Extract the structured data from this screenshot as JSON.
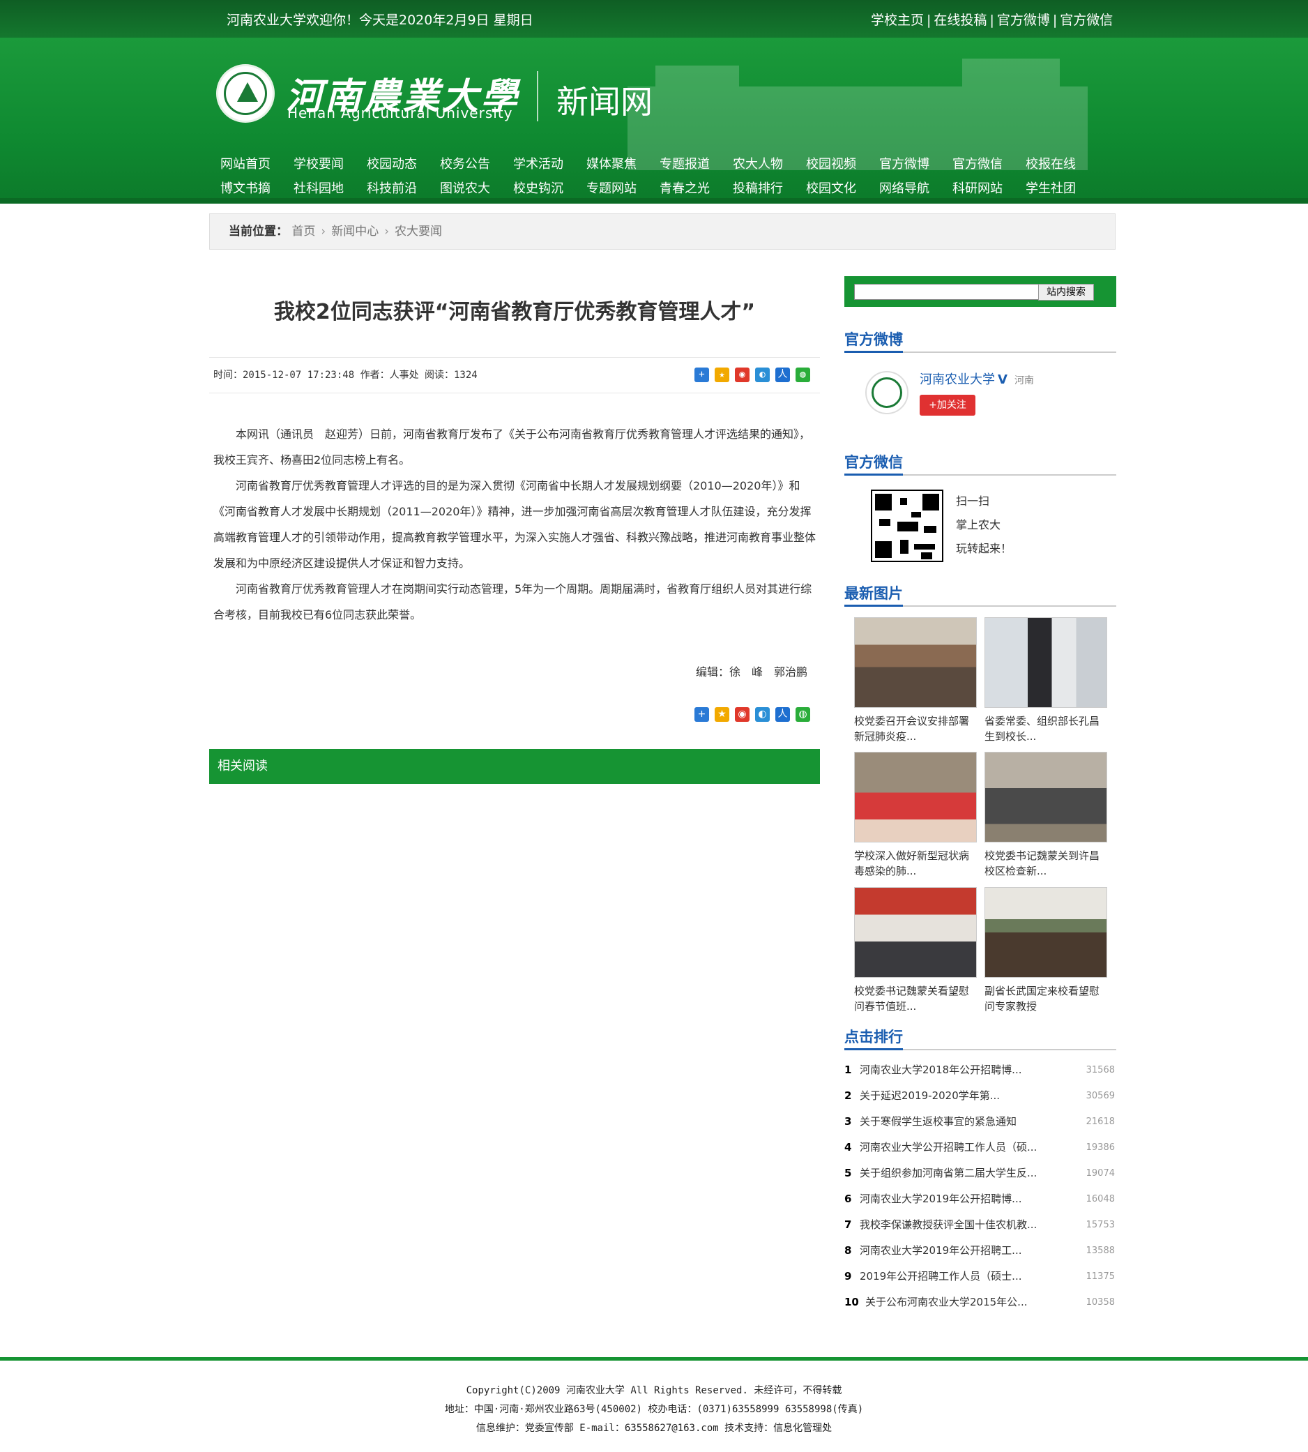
{
  "topbar": {
    "welcome": "河南农业大学欢迎你！今天是2020年2月9日 星期日",
    "links": [
      "学校主页",
      "在线投稿",
      "官方微博",
      "官方微信"
    ]
  },
  "header": {
    "university_cn": "河南農業大學",
    "university_en": "Henan Agricultural University",
    "site_name": "新闻网"
  },
  "nav": {
    "row1": [
      "网站首页",
      "学校要闻",
      "校园动态",
      "校务公告",
      "学术活动",
      "媒体聚焦",
      "专题报道",
      "农大人物",
      "校园视频",
      "官方微博",
      "官方微信",
      "校报在线"
    ],
    "row2": [
      "博文书摘",
      "社科园地",
      "科技前沿",
      "图说农大",
      "校史钩沉",
      "专题网站",
      "青春之光",
      "投稿排行",
      "校园文化",
      "网络导航",
      "科研网站",
      "学生社团"
    ]
  },
  "breadcrumb": {
    "label": "当前位置：",
    "items": [
      "首页",
      "新闻中心",
      "农大要闻"
    ]
  },
  "article": {
    "title": "我校2位同志获评“河南省教育厅优秀教育管理人才”",
    "meta": "时间：2015-12-07 17:23:48  作者：人事处  阅读：1324",
    "paragraphs": [
      "本网讯（通讯员　赵迎芳）日前，河南省教育厅发布了《关于公布河南省教育厅优秀教育管理人才评选结果的通知》，我校王宾齐、杨喜田2位同志榜上有名。",
      "河南省教育厅优秀教育管理人才评选的目的是为深入贯彻《河南省中长期人才发展规划纲要（2010—2020年）》和《河南省教育人才发展中长期规划（2011—2020年）》精神，进一步加强河南省高层次教育管理人才队伍建设，充分发挥高端教育管理人才的引领带动作用，提高教育教学管理水平，为深入实施人才强省、科教兴豫战略，推进河南教育事业整体发展和为中原经济区建设提供人才保证和智力支持。",
      "河南省教育厅优秀教育管理人才在岗期间实行动态管理，5年为一个周期。周期届满时，省教育厅组织人员对其进行综合考核，目前我校已有6位同志获此荣誉。"
    ],
    "editor": "编辑：徐　峰　郭治鹏",
    "share_icons": [
      "plus-icon",
      "qzone-icon",
      "weibo-icon",
      "tencent-icon",
      "renren-icon",
      "wechat-icon"
    ],
    "related_title": "相关阅读"
  },
  "sidebar": {
    "search_button": "站内搜索",
    "weibo_title": "官方微博",
    "weibo_name": "河南农业大学",
    "weibo_verified": "V",
    "weibo_location": "河南",
    "weibo_follow": "+加关注",
    "weixin_title": "官方微信",
    "weixin_lines": [
      "扫一扫",
      "掌上农大",
      "玩转起来！"
    ],
    "photos_title": "最新图片",
    "photos": [
      {
        "caption_1": "校党委召开会议安排部署",
        "caption_2": "新冠肺炎疫..."
      },
      {
        "caption_1": "省委常委、组织部长孔昌",
        "caption_2": "生到校长..."
      },
      {
        "caption_1": "学校深入做好新型冠状病",
        "caption_2": "毒感染的肺..."
      },
      {
        "caption_1": "校党委书记魏蒙关到许昌",
        "caption_2": "校区检查新..."
      },
      {
        "caption_1": "校党委书记魏蒙关看望慰",
        "caption_2": "问春节值班..."
      },
      {
        "caption_1": "副省长武国定来校看望慰",
        "caption_2": "问专家教授"
      }
    ],
    "rank_title": "点击排行",
    "rank": [
      {
        "n": "1",
        "t": "河南农业大学2018年公开招聘博...",
        "c": "31568"
      },
      {
        "n": "2",
        "t": "关于延迟2019-2020学年第...",
        "c": "30569"
      },
      {
        "n": "3",
        "t": "关于寒假学生返校事宜的紧急通知",
        "c": "21618"
      },
      {
        "n": "4",
        "t": "河南农业大学公开招聘工作人员（硕...",
        "c": "19386"
      },
      {
        "n": "5",
        "t": "关于组织参加河南省第二届大学生反...",
        "c": "19074"
      },
      {
        "n": "6",
        "t": "河南农业大学2019年公开招聘博...",
        "c": "16048"
      },
      {
        "n": "7",
        "t": "我校李保谦教授获评全国十佳农机教...",
        "c": "15753"
      },
      {
        "n": "8",
        "t": "河南农业大学2019年公开招聘工...",
        "c": "13588"
      },
      {
        "n": "9",
        "t": "2019年公开招聘工作人员（硕士...",
        "c": "11375"
      },
      {
        "n": "10",
        "t": "关于公布河南农业大学2015年公...",
        "c": "10358"
      }
    ]
  },
  "footer": {
    "line1": "Copyright(C)2009  河南农业大学  All Rights Reserved.  未经许可，不得转载",
    "line2": "地址：中国·河南·郑州农业路63号(450002)  校办电话：(0371)63558999 63558998(传真)",
    "line3": "信息维护：党委宣传部  E-mail：63558627@163.com  技术支持：信息化管理处"
  }
}
